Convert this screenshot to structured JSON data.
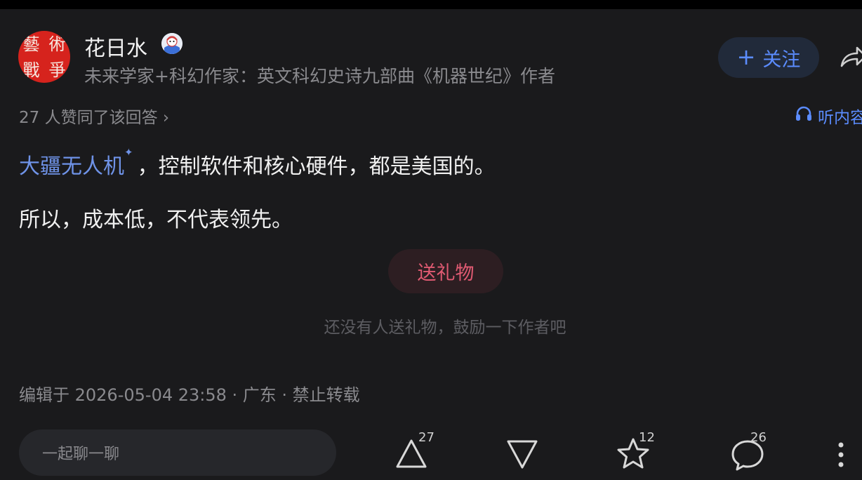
{
  "author": {
    "name": "花日水",
    "bio": "未来学家+科幻作家：英文科幻史诗九部曲《机器世纪》作者",
    "avatar_chars": [
      "藝",
      "術",
      "戰",
      "爭"
    ],
    "badge_icon": "mascot-badge-icon"
  },
  "follow_button": {
    "plus": "+",
    "label": "关注"
  },
  "answer_meta": {
    "likes": "27 人赞同了该回答 ›",
    "listen": "听内容"
  },
  "content": {
    "p1_link": "大疆无人机",
    "p1_sparkle": "✦",
    "p1_rest": "，控制软件和核心硬件，都是美国的。",
    "p2": "所以，成本低，不代表领先。"
  },
  "gift": {
    "button": "送礼物",
    "hint": "还没有人送礼物，鼓励一下作者吧"
  },
  "edit_info": "编辑于 2026-05-04 23:58 · 广东 · 禁止转载",
  "bottom_bar": {
    "comment_placeholder": "一起聊一聊",
    "upvote_count": "27",
    "favorite_count": "12",
    "comment_count": "26"
  },
  "colors": {
    "background": "#1a1a1c",
    "accent_blue": "#5b8cff",
    "gift_red": "#e05a72",
    "avatar_red": "#d6231d"
  }
}
